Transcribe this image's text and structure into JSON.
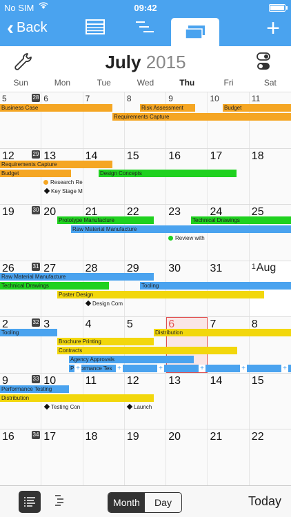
{
  "status_bar": {
    "carrier": "No SIM",
    "time": "09:42"
  },
  "nav": {
    "back_label": "Back",
    "plus": "+"
  },
  "month": {
    "name": "July",
    "year": "2015"
  },
  "weekdays": [
    "Sun",
    "Mon",
    "Tue",
    "Wed",
    "Thu",
    "Fri",
    "Sat"
  ],
  "weeks": [
    {
      "days": [
        "5",
        "6",
        "7",
        "8",
        "9",
        "10",
        "11"
      ],
      "weeknum": "28"
    },
    {
      "days": [
        "12",
        "13",
        "14",
        "15",
        "16",
        "17",
        "18"
      ],
      "weeknum": "29"
    },
    {
      "days": [
        "19",
        "20",
        "21",
        "22",
        "23",
        "24",
        "25"
      ],
      "weeknum": "30"
    },
    {
      "days": [
        "26",
        "27",
        "28",
        "29",
        "30",
        "31",
        "1"
      ],
      "weeknum": "31",
      "month_label": "Aug"
    },
    {
      "days": [
        "2",
        "3",
        "4",
        "5",
        "6",
        "7",
        "8"
      ],
      "weeknum": "32"
    },
    {
      "days": [
        "9",
        "10",
        "11",
        "12",
        "13",
        "14",
        "15"
      ],
      "weeknum": "33"
    },
    {
      "days": [
        "16",
        "17",
        "18",
        "19",
        "20",
        "21",
        "22"
      ],
      "weeknum": "34"
    }
  ],
  "events": {
    "business_case": "Business Case",
    "risk_assessment": "Risk Assessment",
    "budget": "Budget",
    "requirements_capture": "Requirements Capture",
    "design_concepts": "Design Concepts",
    "research": "Research Re",
    "key_stage": "Key Stage M",
    "prototype": "Prototype Manufacture",
    "technical_drawings": "Technical Drawings",
    "raw_material": "Raw Material Manufacture",
    "review": "Review with",
    "tooling": "Tooling",
    "poster_design": "Poster Design",
    "design_com": "Design Com",
    "distribution": "Distribution",
    "brochure": "Brochure Printing",
    "contracts": "Contracts",
    "agency": "Agency Approvals",
    "performance_testing": "Performance Testing",
    "performance_tes": "Performance Tes",
    "testing_con": "Testing Con",
    "launch": "Launch"
  },
  "plus_symbol": "+",
  "bottom": {
    "month": "Month",
    "day": "Day",
    "today": "Today"
  },
  "colors": {
    "accent": "#4aa3ef",
    "orange": "#f5a623",
    "green": "#1fd11f",
    "yellow": "#f2d70c",
    "today": "#e05050"
  }
}
